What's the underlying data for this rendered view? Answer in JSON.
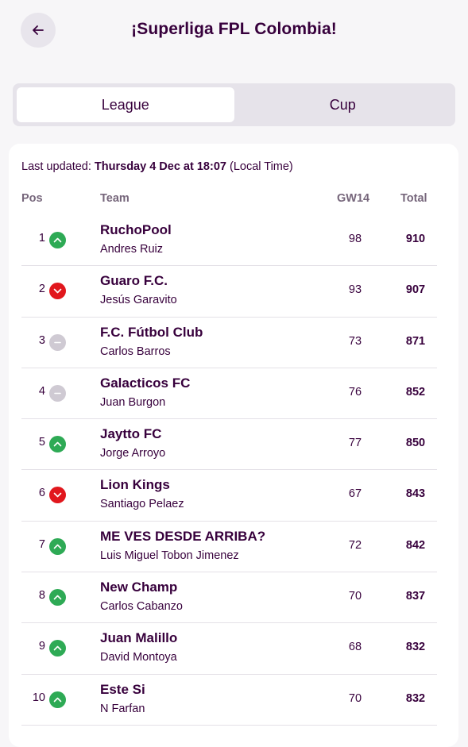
{
  "header": {
    "title": "¡Superliga FPL Colombia!",
    "back_icon": "arrow-left-icon"
  },
  "tabs": [
    {
      "label": "League",
      "active": true
    },
    {
      "label": "Cup",
      "active": false
    }
  ],
  "last_updated": {
    "prefix": "Last updated:",
    "value": "Thursday 4 Dec at 18:07",
    "suffix": "(Local Time)"
  },
  "columns": {
    "pos": "Pos",
    "team": "Team",
    "gw": "GW14",
    "total": "Total"
  },
  "colors": {
    "up": "#2eaa55",
    "down": "#e1171d",
    "same": "#cfcad3",
    "primary": "#37003c"
  },
  "standings": [
    {
      "pos": "1",
      "movement": "up",
      "team": "RuchoPool",
      "manager": "Andres Ruiz",
      "gw": "98",
      "total": "910"
    },
    {
      "pos": "2",
      "movement": "down",
      "team": "Guaro F.C.",
      "manager": "Jesús Garavito",
      "gw": "93",
      "total": "907"
    },
    {
      "pos": "3",
      "movement": "same",
      "team": "F.C. Fútbol Club",
      "manager": "Carlos Barros",
      "gw": "73",
      "total": "871"
    },
    {
      "pos": "4",
      "movement": "same",
      "team": "Galacticos FC",
      "manager": "Juan Burgon",
      "gw": "76",
      "total": "852"
    },
    {
      "pos": "5",
      "movement": "up",
      "team": "Jaytto FC",
      "manager": "Jorge Arroyo",
      "gw": "77",
      "total": "850"
    },
    {
      "pos": "6",
      "movement": "down",
      "team": "Lion Kings",
      "manager": "Santiago Pelaez",
      "gw": "67",
      "total": "843"
    },
    {
      "pos": "7",
      "movement": "up",
      "team": "ME VES DESDE ARRIBA?",
      "manager": "Luis Miguel Tobon Jimenez",
      "gw": "72",
      "total": "842"
    },
    {
      "pos": "8",
      "movement": "up",
      "team": "New Champ",
      "manager": "Carlos Cabanzo",
      "gw": "70",
      "total": "837"
    },
    {
      "pos": "9",
      "movement": "up",
      "team": "Juan Malillo",
      "manager": "David Montoya",
      "gw": "68",
      "total": "832"
    },
    {
      "pos": "10",
      "movement": "up",
      "team": "Este Si",
      "manager": "N Farfan",
      "gw": "70",
      "total": "832"
    }
  ]
}
